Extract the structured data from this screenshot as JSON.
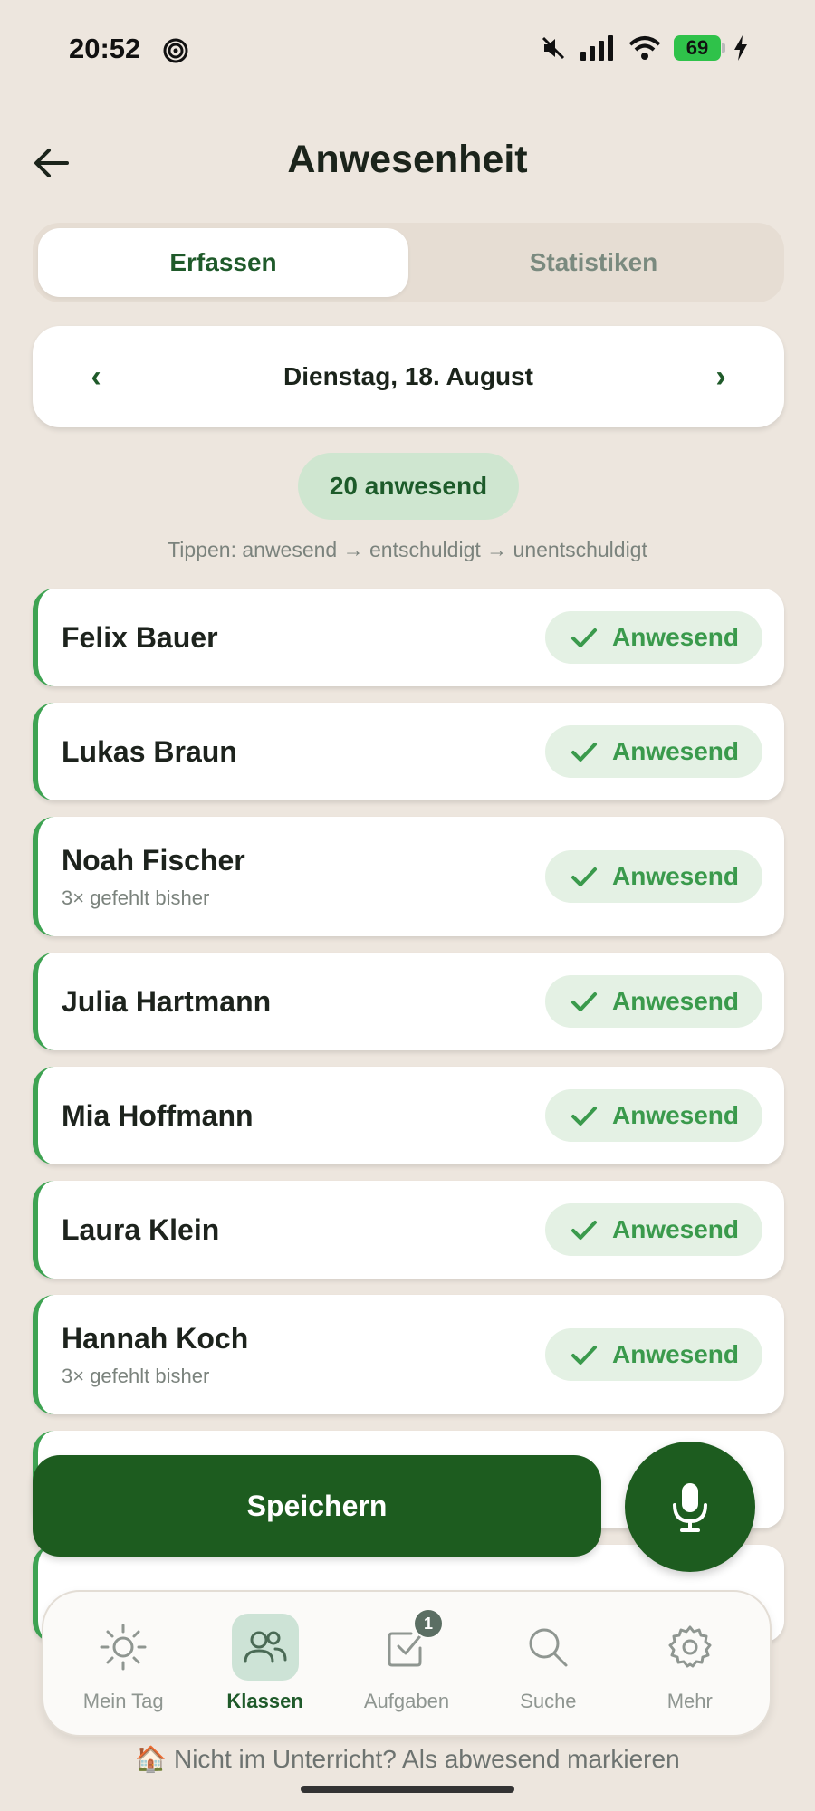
{
  "status_bar": {
    "time": "20:52",
    "battery": "69"
  },
  "header": {
    "title": "Anwesenheit"
  },
  "tabs": [
    {
      "label": "Erfassen",
      "active": true
    },
    {
      "label": "Statistiken",
      "active": false
    }
  ],
  "date_nav": {
    "prev": "‹",
    "label": "Dienstag, 18. August",
    "next": "›"
  },
  "summary": {
    "present_count": "20 anwesend"
  },
  "hint": "Tippen: anwesend → entschuldigt → unentschuldigt",
  "students": [
    {
      "name": "Felix Bauer",
      "note": "",
      "status": "Anwesend"
    },
    {
      "name": "Lukas Braun",
      "note": "",
      "status": "Anwesend"
    },
    {
      "name": "Noah Fischer",
      "note": "3× gefehlt bisher",
      "status": "Anwesend"
    },
    {
      "name": "Julia Hartmann",
      "note": "",
      "status": "Anwesend"
    },
    {
      "name": "Mia Hoffmann",
      "note": "",
      "status": "Anwesend"
    },
    {
      "name": "Laura Klein",
      "note": "",
      "status": "Anwesend"
    },
    {
      "name": "Hannah Koch",
      "note": "3× gefehlt bisher",
      "status": "Anwesend"
    }
  ],
  "actions": {
    "save_label": "Speichern"
  },
  "nav": [
    {
      "label": "Mein Tag",
      "icon": "sun-icon",
      "active": false
    },
    {
      "label": "Klassen",
      "icon": "users-icon",
      "active": true
    },
    {
      "label": "Aufgaben",
      "icon": "task-check-icon",
      "active": false,
      "badge": "1"
    },
    {
      "label": "Suche",
      "icon": "search-icon",
      "active": false
    },
    {
      "label": "Mehr",
      "icon": "gear-icon",
      "active": false
    }
  ],
  "footer": {
    "absent_link": "🏠 Nicht im Unterricht? Als abwesend markieren"
  },
  "colors": {
    "accent": "#1d5c1f",
    "present": "#3ea352",
    "background": "#ede6de"
  }
}
